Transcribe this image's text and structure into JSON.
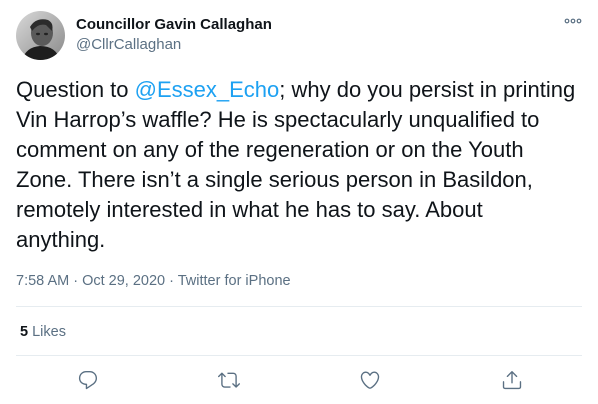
{
  "author": {
    "display_name": "Councillor Gavin Callaghan",
    "handle": "@CllrCallaghan"
  },
  "tweet": {
    "text_before": "Question to ",
    "mention": "@Essex_Echo",
    "text_after": "; why do you persist in printing Vin Harrop’s waffle? He is spectacularly unqualified to comment on any of the regeneration or on the Youth Zone. There isn’t a single serious person in Basildon, remotely interested in what he has to say. About anything."
  },
  "meta": {
    "time": "7:58 AM",
    "separator1": " · ",
    "date": "Oct 29, 2020",
    "separator2": " · ",
    "source": "Twitter for iPhone"
  },
  "stats": {
    "likes_count": "5",
    "likes_label": " Likes"
  },
  "actions": {
    "reply_icon": "reply-icon",
    "retweet_icon": "retweet-icon",
    "like_icon": "heart-icon",
    "share_icon": "share-icon"
  },
  "colors": {
    "accent": "#1da1f2",
    "secondary_text": "#5b7083",
    "divider": "#e6ecf0",
    "primary_text": "#0f1419"
  }
}
